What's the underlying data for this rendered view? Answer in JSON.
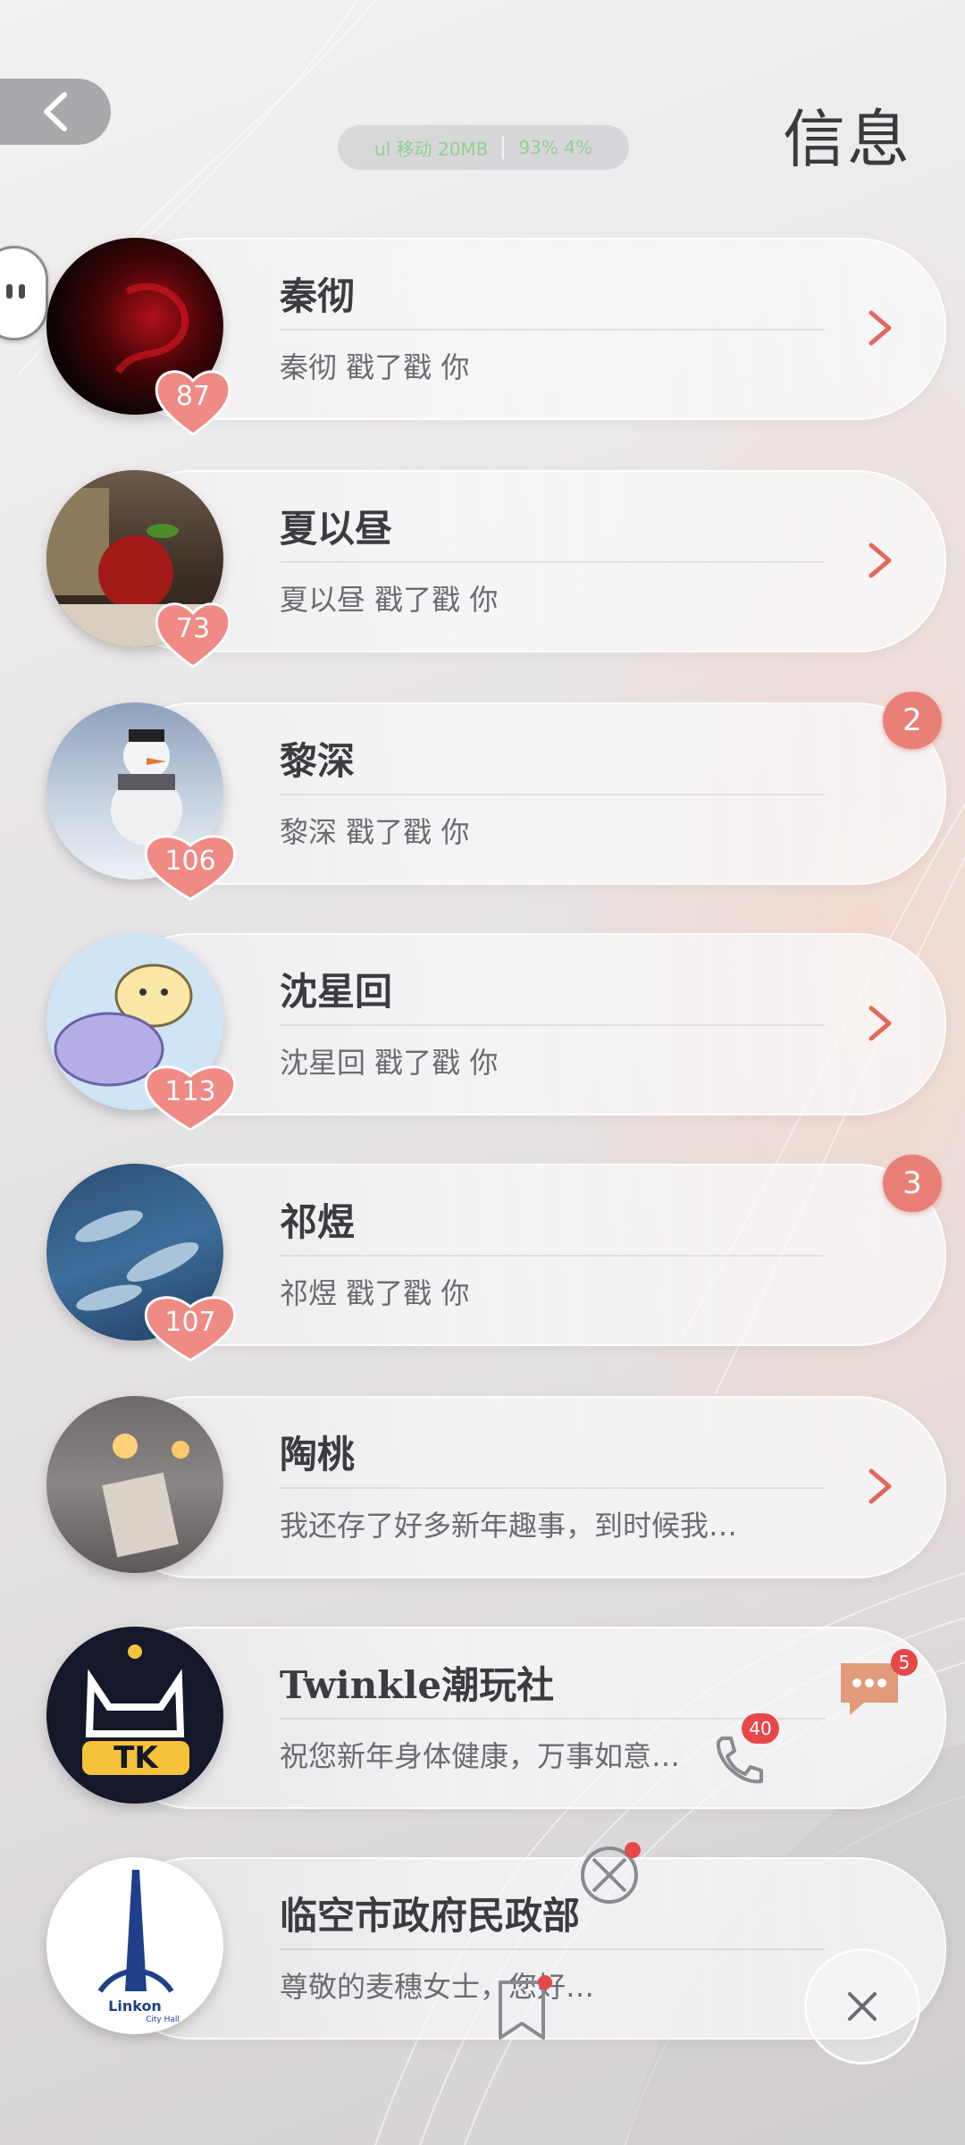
{
  "header": {
    "back_icon": "chevron-left-icon",
    "title": "信息",
    "status_left": "ul 移动 20MB",
    "status_right": "93% 4%"
  },
  "conversations": [
    {
      "name": "秦彻",
      "preview": "秦彻 戳了戳 你",
      "affinity": "87",
      "unread": "",
      "avatar": "dark-red-smoke-avatar"
    },
    {
      "name": "夏以昼",
      "preview": "夏以昼 戳了戳 你",
      "affinity": "73",
      "unread": "",
      "avatar": "apple-avatar"
    },
    {
      "name": "黎深",
      "preview": "黎深 戳了戳 你",
      "affinity": "106",
      "unread": "2",
      "avatar": "snowman-avatar"
    },
    {
      "name": "沈星回",
      "preview": "沈星回 戳了戳 你",
      "affinity": "113",
      "unread": "",
      "avatar": "cartoon-bear-avatar"
    },
    {
      "name": "祁煜",
      "preview": "祁煜 戳了戳 你",
      "affinity": "107",
      "unread": "3",
      "avatar": "dolphins-avatar"
    },
    {
      "name": "陶桃",
      "preview": "我还存了好多新年趣事，到时候我…",
      "affinity": "",
      "unread": "",
      "avatar": "candles-blanket-avatar"
    },
    {
      "name": "Twinkle潮玩社",
      "preview": "祝您新年身体健康，万事如意…",
      "affinity": "",
      "unread": "",
      "avatar": "tk-logo-avatar"
    },
    {
      "name": "临空市政府民政部",
      "preview": "尊敬的麦穗女士，您好…",
      "affinity": "",
      "unread": "",
      "avatar": "linkon-city-hall-avatar",
      "logo_text": "Linkon",
      "logo_sub": "City Hall"
    }
  ],
  "dock": {
    "chat_badge": "5",
    "call_badge": "40",
    "chat_icon": "chat-bubble-icon",
    "call_icon": "phone-icon",
    "moments_icon": "aperture-icon",
    "bookmark_icon": "bookmark-icon",
    "close_icon": "close-icon"
  },
  "colors": {
    "accent": "#e88078",
    "badge": "#e6484a",
    "chevron": "#e2675e"
  }
}
